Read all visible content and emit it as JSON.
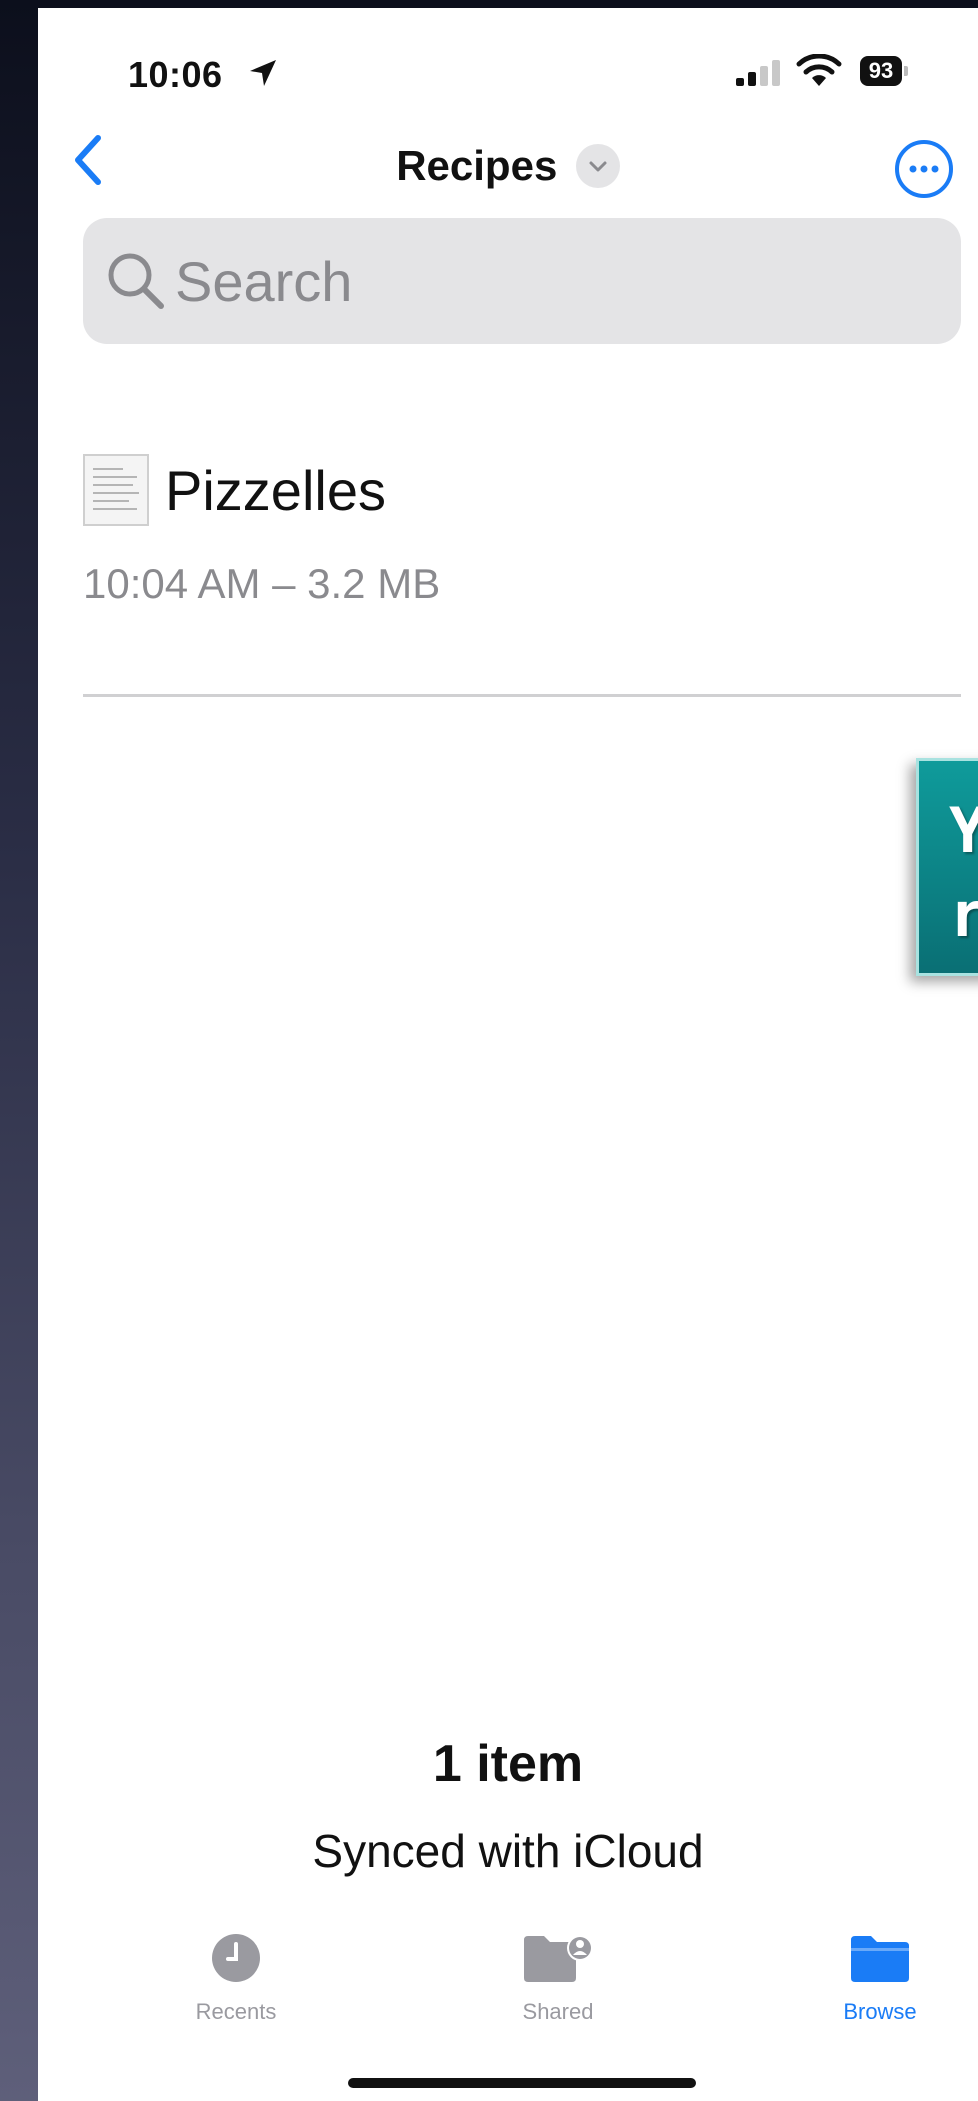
{
  "status_bar": {
    "time": "10:06",
    "battery": "93"
  },
  "nav": {
    "title": "Recipes",
    "back": "back"
  },
  "search": {
    "placeholder": "Search"
  },
  "files": [
    {
      "name": "Pizzelles",
      "meta": "10:04 AM – 3.2 MB"
    }
  ],
  "banner": {
    "text": "Yo\nre"
  },
  "footer": {
    "item_count": "1 item",
    "sync_status": "Synced with iCloud"
  },
  "tabs": [
    {
      "label": "Recents",
      "icon": "clock-icon",
      "active": false
    },
    {
      "label": "Shared",
      "icon": "shared-folder-icon",
      "active": false
    },
    {
      "label": "Browse",
      "icon": "folder-icon",
      "active": true
    }
  ],
  "colors": {
    "accent": "#1a7cf6",
    "banner": "#0f9b9b",
    "inactive_tab": "#9a9aa0"
  }
}
